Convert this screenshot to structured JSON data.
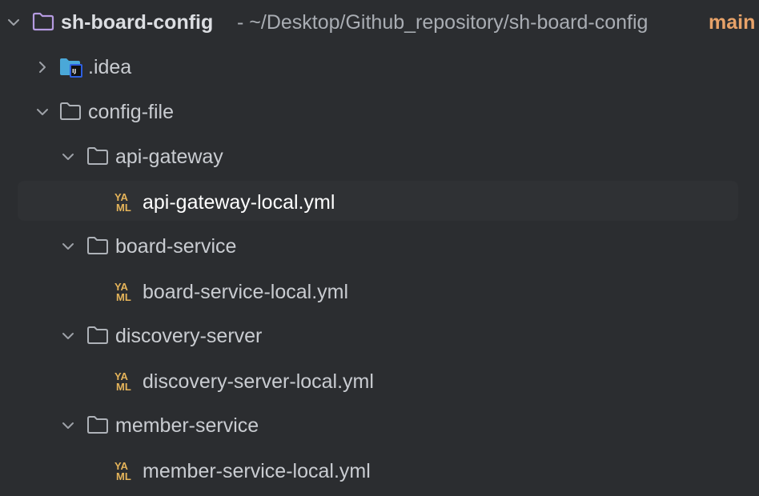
{
  "root": {
    "name": "sh-board-config",
    "path": " - ~/Desktop/Github_repository/sh-board-config",
    "branch": "main"
  },
  "items": [
    {
      "label": ".idea",
      "kind": "idea-folder",
      "expanded": false
    },
    {
      "label": "config-file",
      "kind": "folder",
      "expanded": true
    },
    {
      "label": "api-gateway",
      "kind": "folder",
      "expanded": true
    },
    {
      "label": "api-gateway-local.yml",
      "kind": "yaml-file",
      "selected": true
    },
    {
      "label": "board-service",
      "kind": "folder",
      "expanded": true
    },
    {
      "label": "board-service-local.yml",
      "kind": "yaml-file"
    },
    {
      "label": "discovery-server",
      "kind": "folder",
      "expanded": true
    },
    {
      "label": "discovery-server-local.yml",
      "kind": "yaml-file"
    },
    {
      "label": "member-service",
      "kind": "folder",
      "expanded": true
    },
    {
      "label": "member-service-local.yml",
      "kind": "yaml-file"
    }
  ],
  "yaml_icon": {
    "line1": "YA",
    "line2": "ML"
  },
  "colors": {
    "background": "#2b2d30",
    "root_folder": "#b59be0",
    "branch": "#e7a269",
    "yaml": "#e5b45a",
    "idea_folder": "#4aa8d8"
  }
}
